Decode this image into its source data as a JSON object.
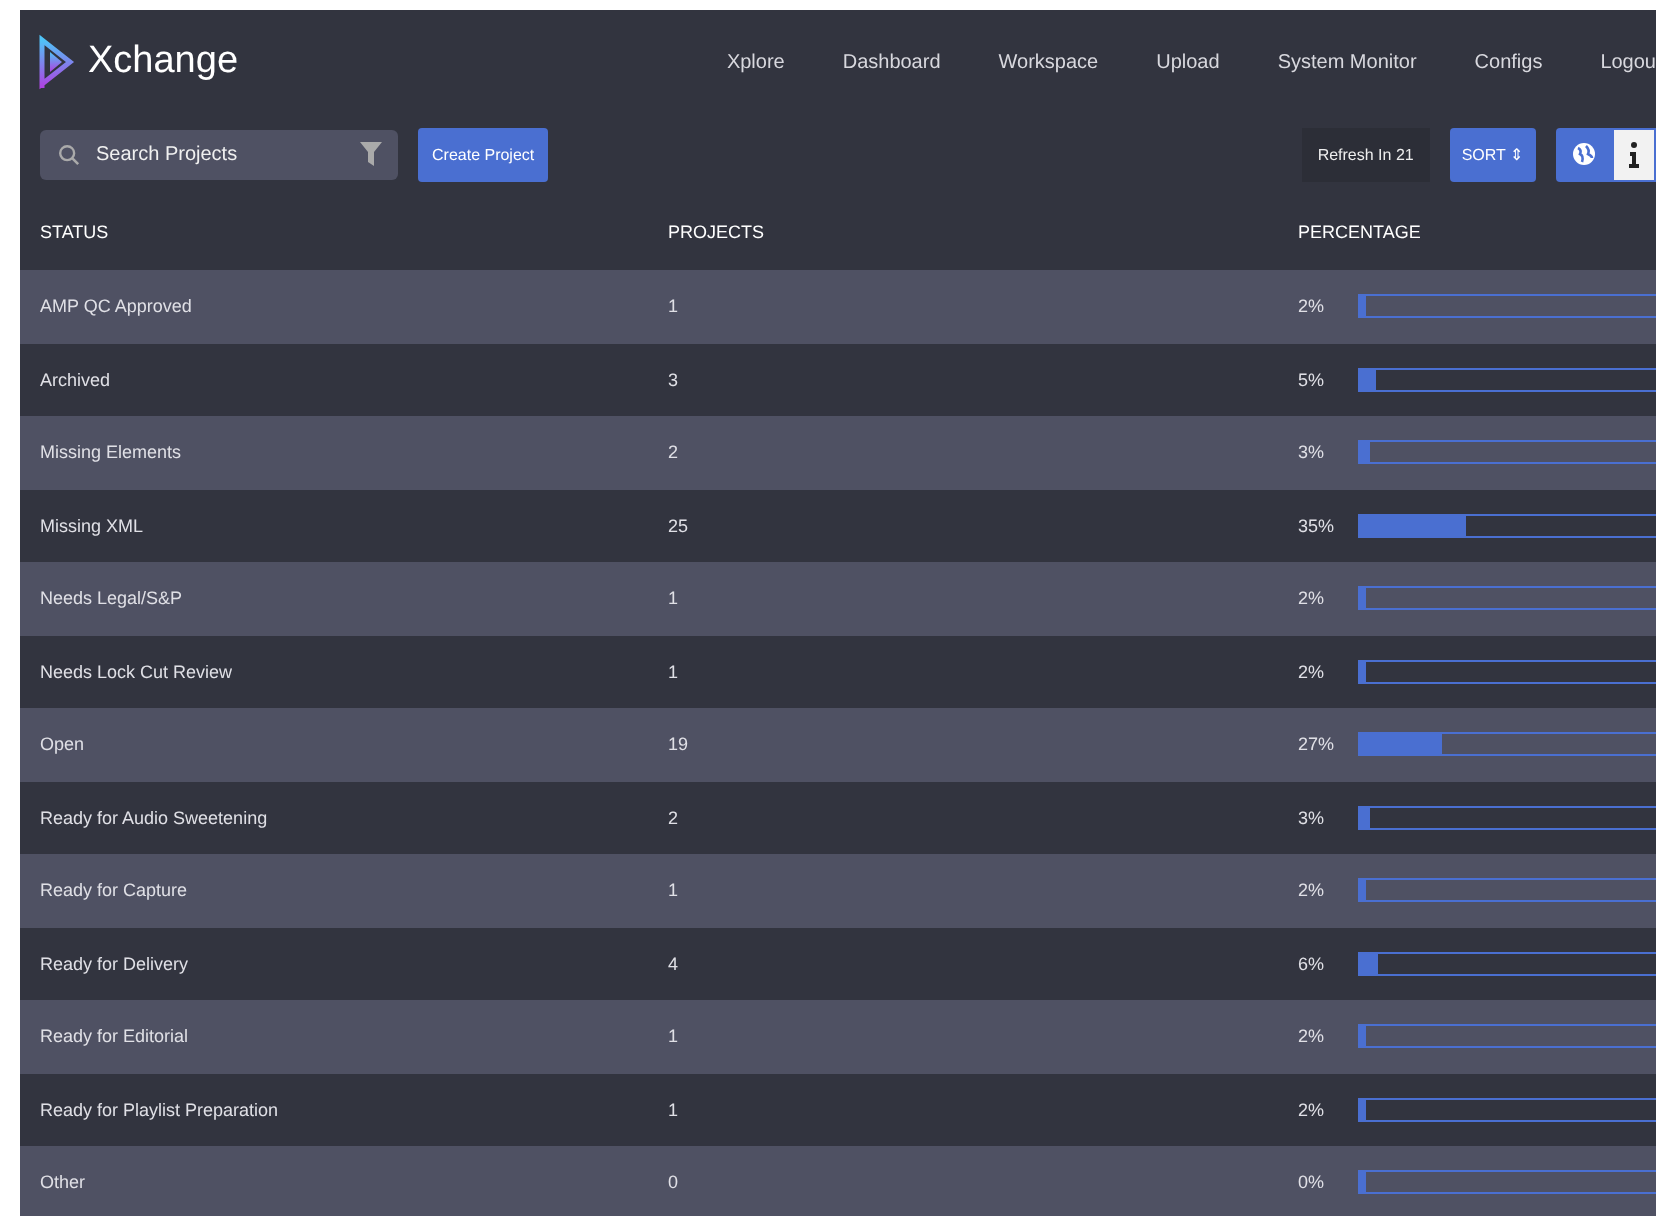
{
  "brand": {
    "name": "Xchange"
  },
  "nav": [
    {
      "label": "Xplore"
    },
    {
      "label": "Dashboard"
    },
    {
      "label": "Workspace"
    },
    {
      "label": "Upload"
    },
    {
      "label": "System Monitor"
    },
    {
      "label": "Configs"
    },
    {
      "label": "Logou"
    }
  ],
  "toolbar": {
    "search": {
      "placeholder": "Search Projects"
    },
    "create_button": "Create Project",
    "refresh": "Refresh In 21",
    "sort_button": "SORT ⇕"
  },
  "table": {
    "columns": [
      "STATUS",
      "PROJECTS",
      "PERCENTAGE"
    ],
    "rows": [
      {
        "status": "AMP QC Approved",
        "projects": "1",
        "percentage": "2%",
        "level": 0.02
      },
      {
        "status": "Archived",
        "projects": "3",
        "percentage": "5%",
        "level": 0.05
      },
      {
        "status": "Missing Elements",
        "projects": "2",
        "percentage": "3%",
        "level": 0.03
      },
      {
        "status": "Missing XML",
        "projects": "25",
        "percentage": "35%",
        "level": 0.35
      },
      {
        "status": "Needs Legal/S&P",
        "projects": "1",
        "percentage": "2%",
        "level": 0.02
      },
      {
        "status": "Needs Lock Cut Review",
        "projects": "1",
        "percentage": "2%",
        "level": 0.02
      },
      {
        "status": "Open",
        "projects": "19",
        "percentage": "27%",
        "level": 0.27
      },
      {
        "status": "Ready for Audio Sweetening",
        "projects": "2",
        "percentage": "3%",
        "level": 0.03
      },
      {
        "status": "Ready for Capture",
        "projects": "1",
        "percentage": "2%",
        "level": 0.02
      },
      {
        "status": "Ready for Delivery",
        "projects": "4",
        "percentage": "6%",
        "level": 0.06
      },
      {
        "status": "Ready for Editorial",
        "projects": "1",
        "percentage": "2%",
        "level": 0.02
      },
      {
        "status": "Ready for Playlist Preparation",
        "projects": "1",
        "percentage": "2%",
        "level": 0.02
      },
      {
        "status": "Other",
        "projects": "0",
        "percentage": "0%",
        "level": 0
      }
    ]
  }
}
